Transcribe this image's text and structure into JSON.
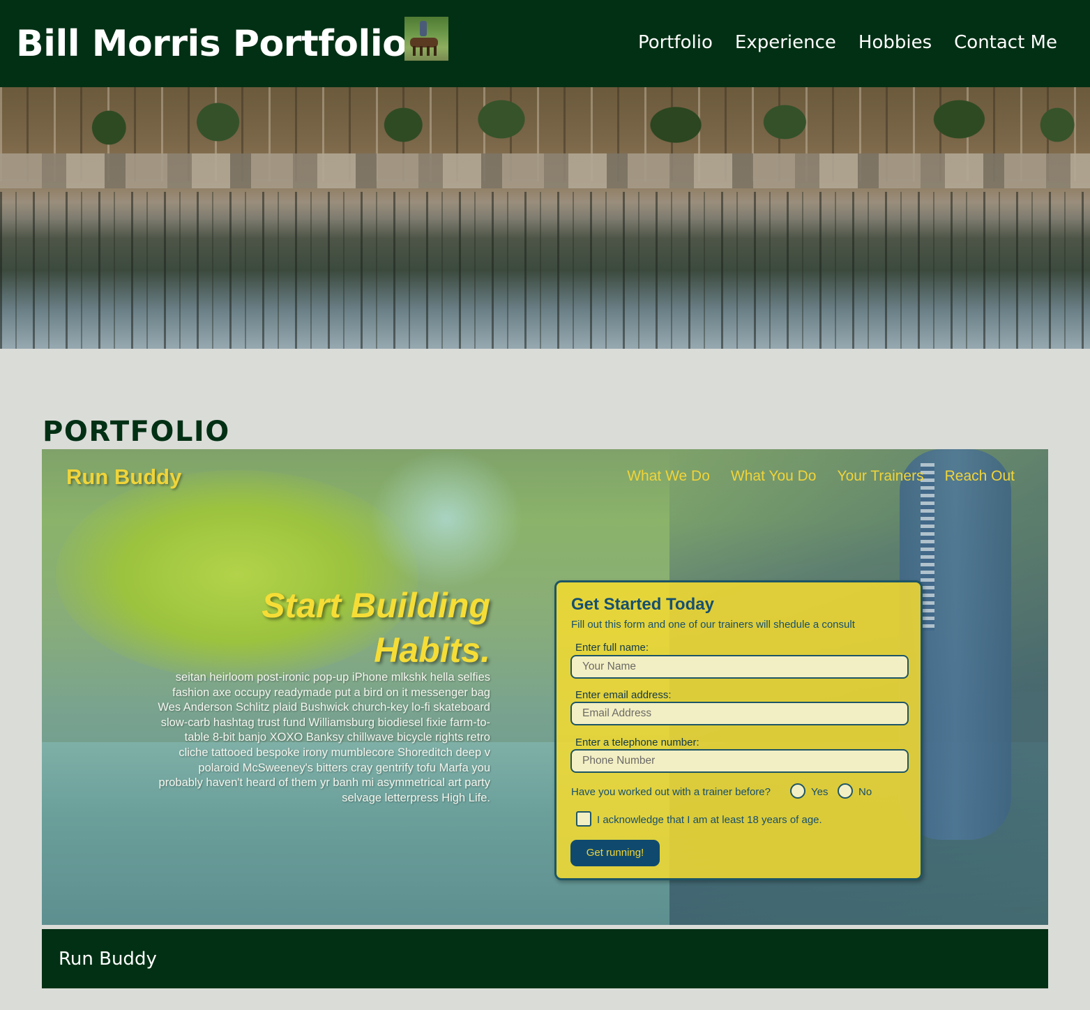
{
  "header": {
    "title": "Bill Morris Portfolio",
    "nav": [
      "Portfolio",
      "Experience",
      "Hobbies",
      "Contact Me"
    ]
  },
  "portfolio": {
    "heading": "PORTFOLIO",
    "project": {
      "caption": "Run Buddy",
      "screenshot": {
        "logo": "Run Buddy",
        "nav": [
          "What We Do",
          "What You Do",
          "Your Trainers",
          "Reach Out"
        ],
        "headline": "Start Building Habits.",
        "body": "seitan heirloom post-ironic pop-up iPhone mlkshk hella selfies fashion axe occupy readymade put a bird on it messenger bag Wes Anderson Schlitz plaid Bushwick church-key lo-fi skateboard slow-carb hashtag trust fund Williamsburg biodiesel fixie farm-to-table 8-bit banjo XOXO Banksy chillwave bicycle rights retro cliche tattooed bespoke irony mumblecore Shoreditch deep v polaroid McSweeney's bitters cray gentrify tofu Marfa you probably haven't heard of them yr banh mi asymmetrical art party selvage letterpress High Life.",
        "form": {
          "title": "Get Started Today",
          "subtitle": "Fill out this form and one of our trainers will shedule a consult",
          "name_label": "Enter full name:",
          "name_placeholder": "Your Name",
          "email_label": "Enter email address:",
          "email_placeholder": "Email Address",
          "phone_label": "Enter a telephone number:",
          "phone_placeholder": "Phone Number",
          "question": "Have you worked out with a trainer before?",
          "yes": "Yes",
          "no": "No",
          "ack": "I acknowledge that I am at least 18 years of age.",
          "button": "Get running!"
        }
      }
    }
  },
  "colors": {
    "header_bg": "#023014",
    "page_bg": "#dadcd8",
    "runbuddy_yellow": "#f0d43a",
    "runbuddy_blue": "#164f6f"
  }
}
